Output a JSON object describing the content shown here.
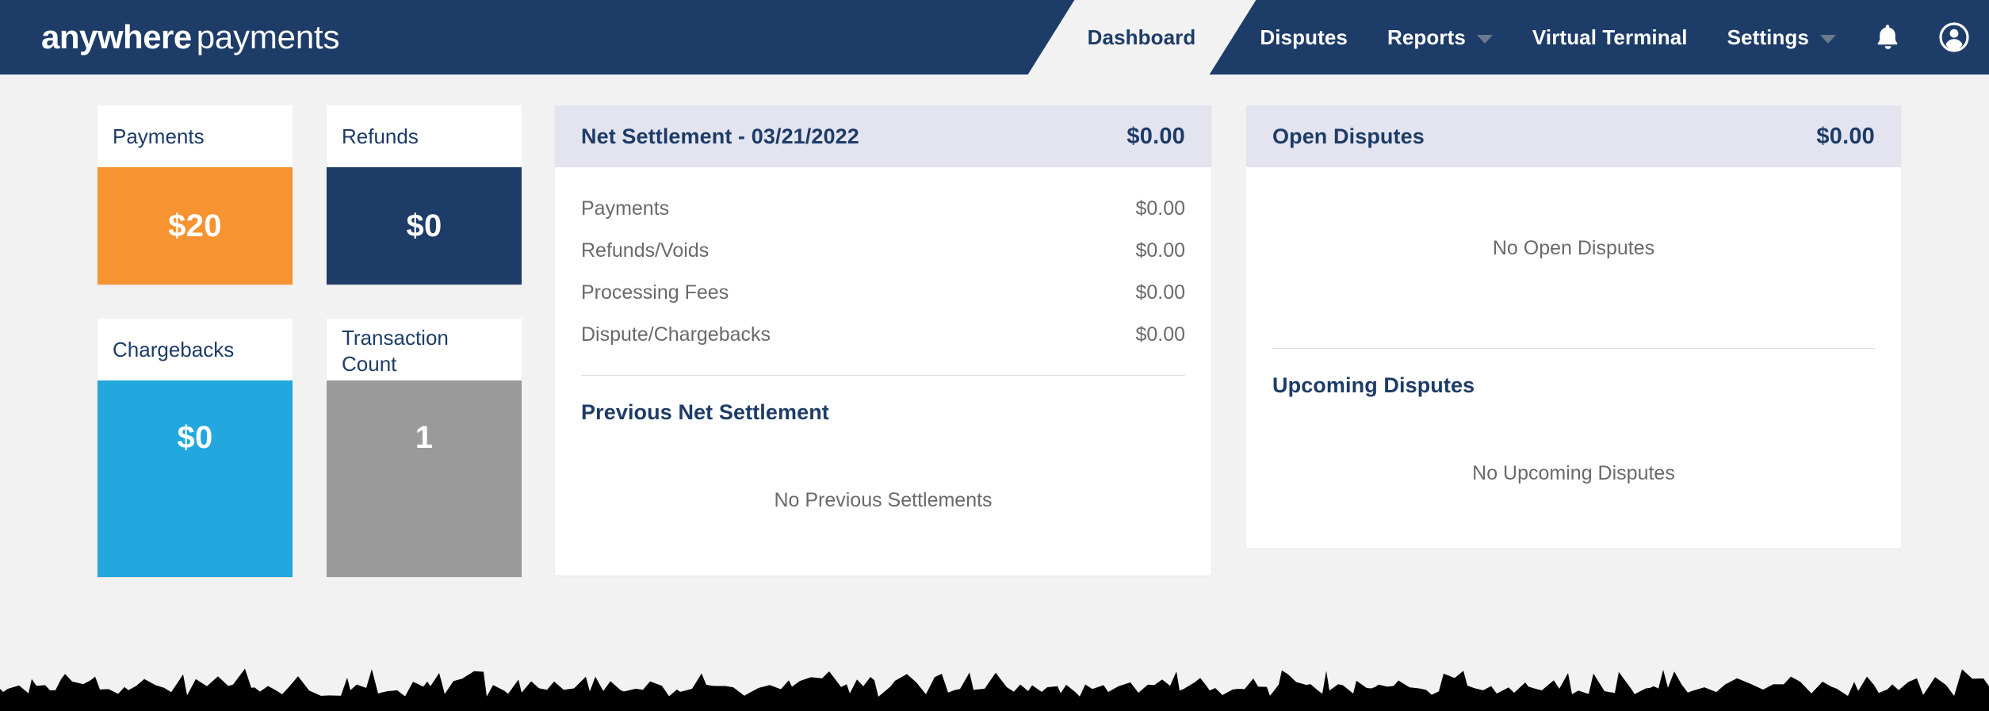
{
  "brand": {
    "name_bold": "anywhere",
    "name_light": "payments"
  },
  "nav": {
    "active_tab": "Dashboard",
    "items": [
      {
        "label": "Disputes",
        "has_caret": false
      },
      {
        "label": "Reports",
        "has_caret": true
      },
      {
        "label": "Virtual Terminal",
        "has_caret": false
      },
      {
        "label": "Settings",
        "has_caret": true
      }
    ],
    "icons": [
      {
        "name": "notifications-bell-icon"
      },
      {
        "name": "account-avatar-icon"
      }
    ]
  },
  "metrics": [
    {
      "title": "Payments",
      "value": "$20",
      "color": "#F79331"
    },
    {
      "title": "Refunds",
      "value": "$0",
      "color": "#1D3C68"
    },
    {
      "title": "Chargebacks",
      "value": "$0",
      "color": "#22A8DE"
    },
    {
      "title": "Transaction Count",
      "value": "1",
      "color": "#9A9A9A"
    }
  ],
  "settlement": {
    "header_title": "Net Settlement - 03/21/2022",
    "header_amount": "$0.00",
    "lines": [
      {
        "label": "Payments",
        "amount": "$0.00"
      },
      {
        "label": "Refunds/Voids",
        "amount": "$0.00"
      },
      {
        "label": "Processing Fees",
        "amount": "$0.00"
      },
      {
        "label": "Dispute/Chargebacks",
        "amount": "$0.00"
      }
    ],
    "previous_title": "Previous Net Settlement",
    "previous_empty": "No Previous Settlements"
  },
  "disputes": {
    "header_title": "Open Disputes",
    "header_amount": "$0.00",
    "open_empty": "No Open Disputes",
    "upcoming_title": "Upcoming Disputes",
    "upcoming_empty": "No Upcoming Disputes"
  },
  "colors": {
    "brand_navy": "#1D3C68",
    "page_bg": "#F2F2F2",
    "panel_header_bg": "#E4E4F0",
    "accent_orange": "#F79331",
    "accent_cyan": "#22A8DE",
    "accent_gray": "#9A9A9A",
    "muted_text": "#6A6A6A"
  }
}
